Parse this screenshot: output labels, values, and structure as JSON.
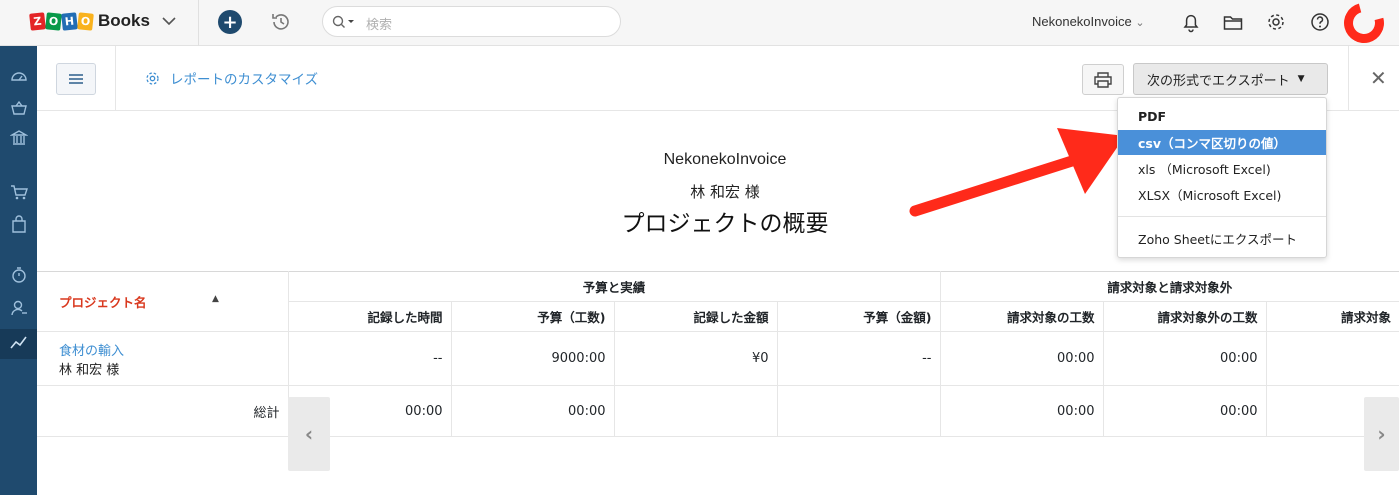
{
  "app": {
    "logo_letters": [
      "Z",
      "O",
      "H",
      "O"
    ],
    "logo_colors": [
      "#e42527",
      "#089949",
      "#226db4",
      "#f9b21d"
    ],
    "product": "Books"
  },
  "search": {
    "placeholder": "検索"
  },
  "header": {
    "org_name": "NekonekoInvoice"
  },
  "toolbar": {
    "customize_label": "レポートのカスタマイズ",
    "export_label": "次の形式でエクスポート"
  },
  "export_menu": {
    "items": [
      "PDF",
      "csv（コンマ区切りの値）",
      "xls （Microsoft Excel)",
      "XLSX（Microsoft Excel)"
    ],
    "selected": "csv（コンマ区切りの値）",
    "sheet_item": "Zoho Sheetにエクスポート"
  },
  "report": {
    "org": "NekonekoInvoice",
    "customer": "林 和宏 様",
    "title": "プロジェクトの概要"
  },
  "table": {
    "project_header": "プロジェクト名",
    "groups": [
      "予算と実績",
      "請求対象と請求対象外"
    ],
    "columns": [
      "記録した時間",
      "予算（工数)",
      "記録した金額",
      "予算（金額)",
      "請求対象の工数",
      "請求対象外の工数",
      "請求対象"
    ],
    "rows": [
      {
        "project": "食材の輸入",
        "customer": "林 和宏 様",
        "values": [
          "--",
          "9000:00",
          "¥0",
          "--",
          "00:00",
          "00:00",
          ""
        ]
      }
    ],
    "total": {
      "label": "総計",
      "values": [
        "00:00",
        "00:00",
        "",
        "",
        "00:00",
        "00:00",
        ""
      ]
    }
  },
  "colors": {
    "sidebar": "#1f4a6e",
    "accent_link": "#3f8fd2",
    "project_header": "#d9381e",
    "selected_item": "#4a90d9",
    "annotation": "#ff2a1a"
  }
}
